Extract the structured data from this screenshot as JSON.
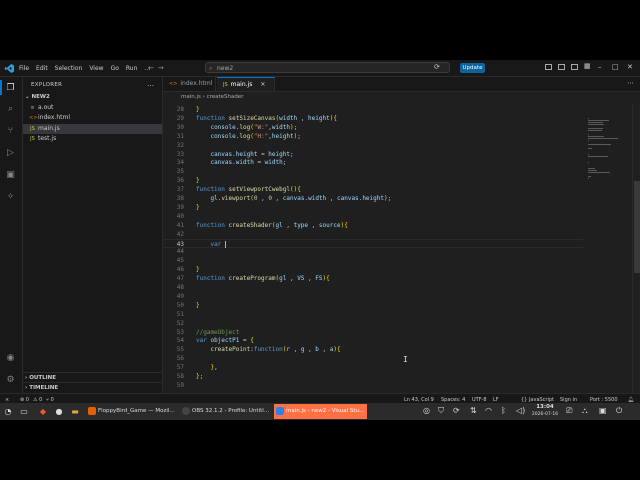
{
  "titlebar": {
    "menu": [
      "File",
      "Edit",
      "Selection",
      "View",
      "Go",
      "Run",
      "…"
    ],
    "search": "new2",
    "update_label": "Update"
  },
  "sidebar": {
    "title": "EXPLORER",
    "folder": "NEW2",
    "files": [
      {
        "name": "a.out",
        "icon": "binary-file-icon"
      },
      {
        "name": "index.html",
        "icon": "html-file-icon"
      },
      {
        "name": "main.js",
        "icon": "js-file-icon",
        "selected": true
      },
      {
        "name": "test.js",
        "icon": "js-file-icon"
      }
    ],
    "outline": "OUTLINE",
    "timeline": "TIMELINE"
  },
  "tabs": [
    {
      "label": "index.html",
      "active": false
    },
    {
      "label": "main.js",
      "active": true
    }
  ],
  "breadcrumb": {
    "file": "main.js",
    "symbol": "createShader"
  },
  "code": [
    {
      "n": "28",
      "t": [
        [
          "br",
          "}"
        ]
      ]
    },
    {
      "n": "29",
      "t": [
        [
          "kw",
          "function "
        ],
        [
          "fn",
          "setSizeCanvas"
        ],
        [
          "br",
          "("
        ],
        [
          "prop",
          "width"
        ],
        [
          "pl",
          " , "
        ],
        [
          "prop",
          "height"
        ],
        [
          "br",
          ")"
        ],
        [
          "br",
          "{"
        ]
      ]
    },
    {
      "n": "30",
      "t": [
        [
          "pl",
          "    "
        ],
        [
          "prop",
          "console"
        ],
        [
          "pl",
          "."
        ],
        [
          "fn",
          "log"
        ],
        [
          "br",
          "("
        ],
        [
          "str",
          "\"W:\""
        ],
        [
          "pl",
          ","
        ],
        [
          "prop",
          "width"
        ],
        [
          "br",
          ")"
        ],
        [
          "pl",
          ";"
        ]
      ]
    },
    {
      "n": "31",
      "t": [
        [
          "pl",
          "    "
        ],
        [
          "prop",
          "console"
        ],
        [
          "pl",
          "."
        ],
        [
          "fn",
          "log"
        ],
        [
          "br",
          "("
        ],
        [
          "str",
          "\"H:\""
        ],
        [
          "pl",
          ","
        ],
        [
          "prop",
          "height"
        ],
        [
          "br",
          ")"
        ],
        [
          "pl",
          ";"
        ]
      ]
    },
    {
      "n": "32",
      "t": []
    },
    {
      "n": "33",
      "t": [
        [
          "pl",
          "    "
        ],
        [
          "prop",
          "canvas"
        ],
        [
          "pl",
          "."
        ],
        [
          "prop",
          "height"
        ],
        [
          "pl",
          " = "
        ],
        [
          "prop",
          "height"
        ],
        [
          "pl",
          ";"
        ]
      ]
    },
    {
      "n": "34",
      "t": [
        [
          "pl",
          "    "
        ],
        [
          "prop",
          "canvas"
        ],
        [
          "pl",
          "."
        ],
        [
          "prop",
          "width"
        ],
        [
          "pl",
          " = "
        ],
        [
          "prop",
          "width"
        ],
        [
          "pl",
          ";"
        ]
      ]
    },
    {
      "n": "35",
      "t": []
    },
    {
      "n": "36",
      "t": [
        [
          "br",
          "}"
        ]
      ]
    },
    {
      "n": "37",
      "t": [
        [
          "kw",
          "function "
        ],
        [
          "fn",
          "setViewportCwebgl"
        ],
        [
          "br",
          "("
        ],
        [
          "br",
          ")"
        ],
        [
          "br",
          "{"
        ]
      ]
    },
    {
      "n": "38",
      "t": [
        [
          "pl",
          "    "
        ],
        [
          "prop",
          "gl"
        ],
        [
          "pl",
          "."
        ],
        [
          "fn",
          "viewport"
        ],
        [
          "br",
          "("
        ],
        [
          "num",
          "0"
        ],
        [
          "pl",
          " , "
        ],
        [
          "num",
          "0"
        ],
        [
          "pl",
          " , "
        ],
        [
          "prop",
          "canvas"
        ],
        [
          "pl",
          "."
        ],
        [
          "prop",
          "width"
        ],
        [
          "pl",
          " , "
        ],
        [
          "prop",
          "canvas"
        ],
        [
          "pl",
          "."
        ],
        [
          "prop",
          "height"
        ],
        [
          "br",
          ")"
        ],
        [
          "pl",
          ";"
        ]
      ]
    },
    {
      "n": "39",
      "t": [
        [
          "br",
          "}"
        ]
      ]
    },
    {
      "n": "40",
      "t": []
    },
    {
      "n": "41",
      "t": [
        [
          "kw",
          "function "
        ],
        [
          "fn",
          "createShader"
        ],
        [
          "br",
          "("
        ],
        [
          "prop",
          "gl"
        ],
        [
          "pl",
          " , "
        ],
        [
          "prop",
          "type"
        ],
        [
          "pl",
          " , "
        ],
        [
          "prop",
          "source"
        ],
        [
          "br",
          ")"
        ],
        [
          "br",
          "{"
        ]
      ]
    },
    {
      "n": "42",
      "t": []
    },
    {
      "n": "43",
      "t": [
        [
          "pl",
          "    "
        ],
        [
          "kw",
          "var "
        ]
      ],
      "cursor": true
    },
    {
      "n": "44",
      "t": []
    },
    {
      "n": "45",
      "t": []
    },
    {
      "n": "46",
      "t": [
        [
          "br",
          "}"
        ]
      ]
    },
    {
      "n": "47",
      "t": [
        [
          "kw",
          "function "
        ],
        [
          "fn",
          "createProgram"
        ],
        [
          "br",
          "("
        ],
        [
          "prop",
          "gl"
        ],
        [
          "pl",
          " , "
        ],
        [
          "prop",
          "VS"
        ],
        [
          "pl",
          " , "
        ],
        [
          "prop",
          "FS"
        ],
        [
          "br",
          ")"
        ],
        [
          "br",
          "{"
        ]
      ]
    },
    {
      "n": "48",
      "t": []
    },
    {
      "n": "49",
      "t": []
    },
    {
      "n": "50",
      "t": [
        [
          "br",
          "}"
        ]
      ]
    },
    {
      "n": "51",
      "t": []
    },
    {
      "n": "52",
      "t": []
    },
    {
      "n": "53",
      "t": [
        [
          "cm",
          "//gameObject"
        ]
      ]
    },
    {
      "n": "54",
      "t": [
        [
          "kw",
          "var "
        ],
        [
          "prop",
          "objectP1"
        ],
        [
          "pl",
          " = "
        ],
        [
          "br",
          "{"
        ]
      ]
    },
    {
      "n": "55",
      "t": [
        [
          "pl",
          "    "
        ],
        [
          "fn",
          "createPoint"
        ],
        [
          "pl",
          ":"
        ],
        [
          "kw",
          "function"
        ],
        [
          "br",
          "("
        ],
        [
          "prop",
          "r"
        ],
        [
          "pl",
          " , "
        ],
        [
          "prop",
          "g"
        ],
        [
          "pl",
          " , "
        ],
        [
          "prop",
          "b"
        ],
        [
          "pl",
          " , "
        ],
        [
          "prop",
          "a"
        ],
        [
          "br",
          ")"
        ],
        [
          "br",
          "{"
        ]
      ]
    },
    {
      "n": "56",
      "t": []
    },
    {
      "n": "57",
      "t": [
        [
          "pl",
          "    "
        ],
        [
          "br",
          "}"
        ],
        [
          "pl",
          ","
        ]
      ]
    },
    {
      "n": "58",
      "t": [
        [
          "br",
          "}"
        ],
        [
          "pl",
          ";"
        ]
      ]
    },
    {
      "n": "59",
      "t": []
    }
  ],
  "statusbar": {
    "errors": "⊗ 0",
    "warnings": "⚠ 0",
    "ports": "⑂ 0",
    "position": "Ln 43, Col 9",
    "spaces": "Spaces: 4",
    "encoding": "UTF-8",
    "eol": "LF",
    "language": "{} JavaScript",
    "signin": "Sign in",
    "port": "Port : 5500"
  },
  "taskbar": {
    "tasks": [
      {
        "label": "FloppyBird_Game — Mozil…",
        "color": "#e66000",
        "active": false
      },
      {
        "label": "OBS 32.1.2 - Profile: Untitl…",
        "color": "#444444",
        "active": false
      },
      {
        "label": "main.js - new2 - Visual Stu…",
        "color": "#2f80ed",
        "active": true
      }
    ],
    "time": "13:04",
    "date": "2026-07-16"
  }
}
